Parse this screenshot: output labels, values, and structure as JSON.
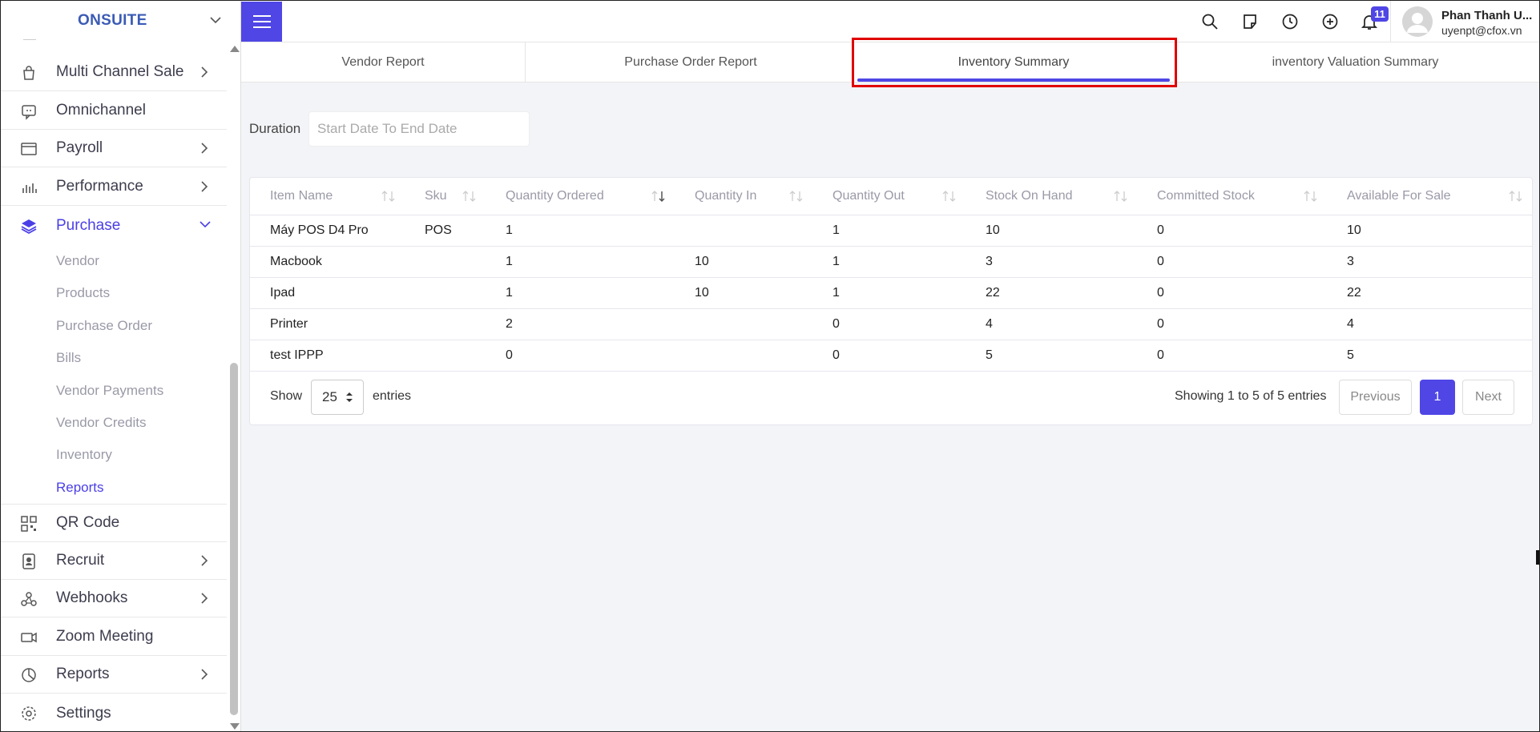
{
  "app": {
    "brand": "ONSUITE"
  },
  "sidebar": {
    "items": [
      {
        "label": "Multi Channel Sale",
        "icon": "shopping-bag-icon",
        "chevron": true
      },
      {
        "label": "Omnichannel",
        "icon": "chat-icon",
        "chevron": false
      },
      {
        "label": "Payroll",
        "icon": "wallet-icon",
        "chevron": true
      },
      {
        "label": "Performance",
        "icon": "bar-chart-icon",
        "chevron": true
      },
      {
        "label": "Purchase",
        "icon": "layers-icon",
        "chevron": true,
        "expanded": true,
        "active": true
      },
      {
        "label": "QR Code",
        "icon": "qr-code-icon",
        "chevron": false
      },
      {
        "label": "Recruit",
        "icon": "badge-icon",
        "chevron": true
      },
      {
        "label": "Webhooks",
        "icon": "webhook-icon",
        "chevron": true
      },
      {
        "label": "Zoom Meeting",
        "icon": "video-icon",
        "chevron": false
      },
      {
        "label": "Reports",
        "icon": "pie-chart-icon",
        "chevron": true
      },
      {
        "label": "Settings",
        "icon": "gear-icon",
        "chevron": false
      }
    ],
    "purchase_sub": [
      {
        "label": "Vendor"
      },
      {
        "label": "Products"
      },
      {
        "label": "Purchase Order"
      },
      {
        "label": "Bills"
      },
      {
        "label": "Vendor Payments"
      },
      {
        "label": "Vendor Credits"
      },
      {
        "label": "Inventory"
      },
      {
        "label": "Reports",
        "active": true
      }
    ]
  },
  "header": {
    "notifications_count": "11",
    "user_name": "Phan Thanh U...",
    "user_email": "uyenpt@cfox.vn"
  },
  "tabs": [
    {
      "label": "Vendor Report"
    },
    {
      "label": "Purchase Order Report"
    },
    {
      "label": "Inventory Summary",
      "active": true
    },
    {
      "label": "inventory Valuation Summary"
    }
  ],
  "filters": {
    "duration_label": "Duration",
    "duration_placeholder": "Start Date To End Date"
  },
  "table": {
    "columns": [
      "Item Name",
      "Sku",
      "Quantity Ordered",
      "Quantity In",
      "Quantity Out",
      "Stock On Hand",
      "Committed Stock",
      "Available For Sale"
    ],
    "rows": [
      [
        "Máy POS D4 Pro",
        "POS",
        "1",
        "",
        "1",
        "10",
        "0",
        "10"
      ],
      [
        "Macbook",
        "",
        "1",
        "10",
        "1",
        "3",
        "0",
        "3"
      ],
      [
        "Ipad",
        "",
        "1",
        "10",
        "1",
        "22",
        "0",
        "22"
      ],
      [
        "Printer",
        "",
        "2",
        "",
        "0",
        "4",
        "0",
        "4"
      ],
      [
        "test IPPP",
        "",
        "0",
        "",
        "0",
        "5",
        "0",
        "5"
      ]
    ]
  },
  "pagination": {
    "show_label": "Show",
    "page_size": "25",
    "entries_label": "entries",
    "info": "Showing 1 to 5 of 5 entries",
    "previous": "Previous",
    "current_page": "1",
    "next": "Next"
  },
  "colors": {
    "accent": "#4f46e5",
    "highlight": "#e00000"
  }
}
